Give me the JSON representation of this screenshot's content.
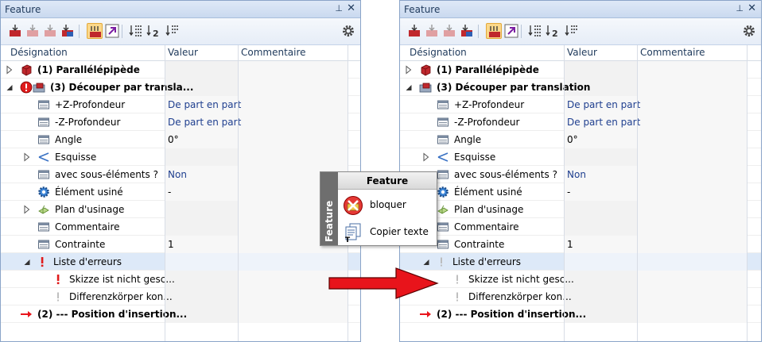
{
  "panels": [
    {
      "title": "Feature",
      "columns": {
        "name": "Désignation",
        "value": "Valeur",
        "comment": "Commentaire"
      },
      "rows": [
        {
          "indent": 0,
          "expander": "collapsed",
          "icon": "red-cuboid-icon",
          "label": "(1) Parallélépipède",
          "bold": true,
          "value": ""
        },
        {
          "indent": 0,
          "expander": "expanded",
          "icon": "error-cut-icon",
          "label": "(3) Découper par translа...",
          "bold": true,
          "value": ""
        },
        {
          "indent": 2,
          "expander": "",
          "icon": "parameter-icon",
          "label": "+Z-Profondeur",
          "bold": false,
          "value": "De part en part",
          "blue": true
        },
        {
          "indent": 2,
          "expander": "",
          "icon": "parameter-icon",
          "label": "-Z-Profondeur",
          "bold": false,
          "value": "De part en part",
          "blue": true
        },
        {
          "indent": 2,
          "expander": "",
          "icon": "parameter-icon",
          "label": "Angle",
          "bold": false,
          "value": "0°"
        },
        {
          "indent": 1,
          "expander": "collapsed",
          "icon": "sketch-icon",
          "label": "Esquisse",
          "bold": false,
          "value": ""
        },
        {
          "indent": 2,
          "expander": "",
          "icon": "parameter-icon",
          "label": "avec sous-éléments ?",
          "bold": false,
          "value": "Non",
          "blue": true
        },
        {
          "indent": 2,
          "expander": "",
          "icon": "gear-blue-icon",
          "label": "Élément usiné",
          "bold": false,
          "value": "-"
        },
        {
          "indent": 1,
          "expander": "collapsed",
          "icon": "plane-icon",
          "label": "Plan d'usinage",
          "bold": false,
          "value": ""
        },
        {
          "indent": 2,
          "expander": "",
          "icon": "parameter-icon",
          "label": "Commentaire",
          "bold": false,
          "value": ""
        },
        {
          "indent": 2,
          "expander": "",
          "icon": "parameter-icon",
          "label": "Contrainte",
          "bold": false,
          "value": "1"
        },
        {
          "indent": 1,
          "expander": "expanded",
          "icon": "red-exclamation-icon",
          "label": "Liste d'erreurs",
          "bold": false,
          "value": "",
          "selected": true
        },
        {
          "indent": 2,
          "expander": "",
          "icon": "red-exclamation-icon",
          "label": "Skizze ist nicht gesc...",
          "bold": false,
          "value": ""
        },
        {
          "indent": 2,
          "expander": "",
          "icon": "grey-exclamation-icon",
          "label": "Differenzkörper kon...",
          "bold": false,
          "value": ""
        },
        {
          "indent": 0,
          "expander": "",
          "icon": "red-arrow-icon",
          "label": "(2) --- Position  d'insertion...",
          "bold": true,
          "value": ""
        }
      ]
    },
    {
      "title": "Feature",
      "columns": {
        "name": "Désignation",
        "value": "Valeur",
        "comment": "Commentaire"
      },
      "rows": [
        {
          "indent": 0,
          "expander": "collapsed",
          "icon": "red-cuboid-icon",
          "label": "(1) Parallélépipède",
          "bold": true,
          "value": ""
        },
        {
          "indent": 0,
          "expander": "expanded",
          "icon": "cut-icon",
          "label": "(3) Découper par translation",
          "bold": true,
          "value": ""
        },
        {
          "indent": 2,
          "expander": "",
          "icon": "parameter-icon",
          "label": "+Z-Profondeur",
          "bold": false,
          "value": "De part en part",
          "blue": true
        },
        {
          "indent": 2,
          "expander": "",
          "icon": "parameter-icon",
          "label": "-Z-Profondeur",
          "bold": false,
          "value": "De part en part",
          "blue": true
        },
        {
          "indent": 2,
          "expander": "",
          "icon": "parameter-icon",
          "label": "Angle",
          "bold": false,
          "value": "0°"
        },
        {
          "indent": 1,
          "expander": "collapsed",
          "icon": "sketch-icon",
          "label": "Esquisse",
          "bold": false,
          "value": ""
        },
        {
          "indent": 2,
          "expander": "",
          "icon": "parameter-icon",
          "label": "avec sous-éléments ?",
          "bold": false,
          "value": "Non",
          "blue": true
        },
        {
          "indent": 2,
          "expander": "",
          "icon": "gear-blue-icon",
          "label": "Élément usiné",
          "bold": false,
          "value": "-"
        },
        {
          "indent": 1,
          "expander": "collapsed",
          "icon": "plane-icon",
          "label": "Plan d'usinage",
          "bold": false,
          "value": ""
        },
        {
          "indent": 2,
          "expander": "",
          "icon": "parameter-icon",
          "label": "Commentaire",
          "bold": false,
          "value": ""
        },
        {
          "indent": 2,
          "expander": "",
          "icon": "parameter-icon",
          "label": "Contrainte",
          "bold": false,
          "value": "1"
        },
        {
          "indent": 1,
          "expander": "expanded",
          "icon": "grey-exclamation-icon",
          "label": "Liste d'erreurs",
          "bold": false,
          "value": "",
          "selected": true
        },
        {
          "indent": 2,
          "expander": "",
          "icon": "grey-exclamation-icon",
          "label": "Skizze ist nicht gesc...",
          "bold": false,
          "value": ""
        },
        {
          "indent": 2,
          "expander": "",
          "icon": "grey-exclamation-icon",
          "label": "Differenzkörper kon...",
          "bold": false,
          "value": ""
        },
        {
          "indent": 0,
          "expander": "",
          "icon": "red-arrow-icon",
          "label": "(2) --- Position  d'insertion...",
          "bold": true,
          "value": ""
        }
      ]
    }
  ],
  "context_menu": {
    "side_label": "Feature",
    "header": "Feature",
    "items": [
      {
        "icon": "block-icon",
        "label": "bloquer"
      },
      {
        "icon": "copy-text-icon",
        "label": "Copier texte"
      }
    ]
  },
  "colors": {
    "accent": "#1e395b",
    "error": "#e01b1b",
    "selection": "#dde9f8",
    "arrow": "#e8141b"
  }
}
